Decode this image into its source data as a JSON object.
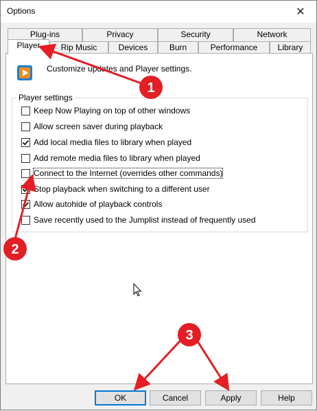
{
  "window": {
    "title": "Options",
    "close_glyph": "✕"
  },
  "tabs_row1": [
    {
      "label": "Plug-ins"
    },
    {
      "label": "Privacy"
    },
    {
      "label": "Security"
    },
    {
      "label": "Network"
    }
  ],
  "tabs_row2": [
    {
      "label": "Player",
      "active": true
    },
    {
      "label": "Rip Music"
    },
    {
      "label": "Devices"
    },
    {
      "label": "Burn"
    },
    {
      "label": "Performance"
    },
    {
      "label": "Library"
    }
  ],
  "header": {
    "text": "Customize updates and Player settings.",
    "icon": "windows-media-player-icon"
  },
  "player_settings": {
    "title": "Player settings",
    "options": [
      {
        "label": "Keep Now Playing on top of other windows",
        "checked": false
      },
      {
        "label": "Allow screen saver during playback",
        "checked": false
      },
      {
        "label": "Add local media files to library when played",
        "checked": true
      },
      {
        "label": "Add remote media files to library when played",
        "checked": false
      },
      {
        "label": "Connect to the Internet (overrides other commands)",
        "checked": false
      },
      {
        "label": "Stop playback when switching to a different user",
        "checked": true
      },
      {
        "label": "Allow autohide of playback controls",
        "checked": true
      },
      {
        "label": "Save recently used to the Jumplist instead of frequently used",
        "checked": false
      }
    ]
  },
  "buttons": {
    "ok": "OK",
    "cancel": "Cancel",
    "apply": "Apply",
    "help": "Help"
  },
  "annotations": {
    "color": "#e31e24",
    "badges": [
      "1",
      "2",
      "3"
    ]
  }
}
